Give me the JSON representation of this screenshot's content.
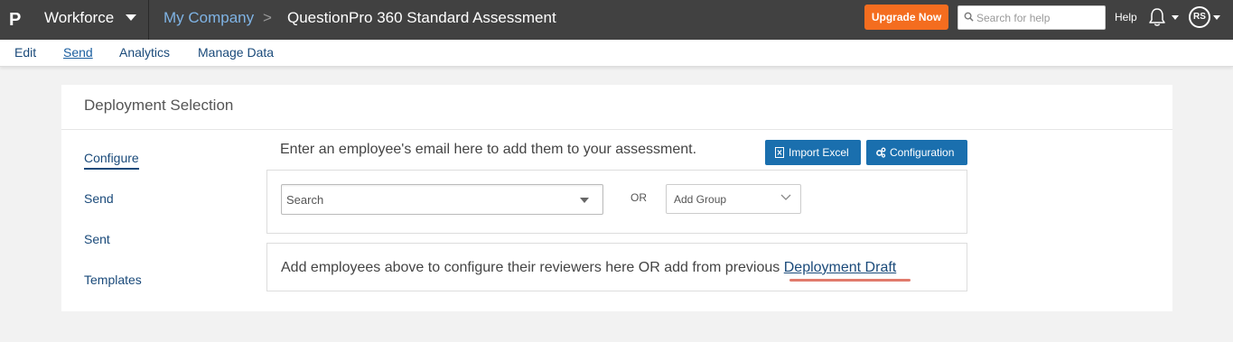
{
  "topbar": {
    "logo_letter": "P",
    "product": "Workforce",
    "company": "My Company",
    "crumb_separator": ">",
    "survey_title": "QuestionPro 360 Standard Assessment",
    "upgrade_label": "Upgrade Now",
    "help_search_placeholder": "Search for help",
    "help_label": "Help",
    "avatar_initials": "RS"
  },
  "subnav": {
    "tabs": [
      {
        "label": "Edit"
      },
      {
        "label": "Send"
      },
      {
        "label": "Analytics"
      },
      {
        "label": "Manage Data"
      }
    ],
    "active_tab": "Send"
  },
  "panel": {
    "title": "Deployment Selection",
    "sidebar": [
      {
        "label": "Configure"
      },
      {
        "label": "Send"
      },
      {
        "label": "Sent"
      },
      {
        "label": "Templates"
      }
    ],
    "active_sidebar": "Configure",
    "instruction": "Enter an employee's email here to add them to your assessment.",
    "import_label": "Import Excel",
    "config_label": "Configuration",
    "search_placeholder": "Search",
    "or_label": "OR",
    "group_placeholder": "Add Group",
    "draft_text": "Add employees above to configure their reviewers here OR add from previous ",
    "draft_link": "Deployment Draft"
  },
  "colors": {
    "topbar_bg": "#414141",
    "upgrade": "#f46d1f",
    "primary_button": "#1a6fae",
    "link": "#1a4a7a",
    "draft_highlight": "#e07a6c"
  },
  "icons": {
    "logo": "questionpro-logo-icon",
    "help_search": "search-icon",
    "notifications": "bell-icon",
    "import": "excel-file-icon",
    "configuration": "gears-icon",
    "dropdown": "chevron-down-icon"
  }
}
